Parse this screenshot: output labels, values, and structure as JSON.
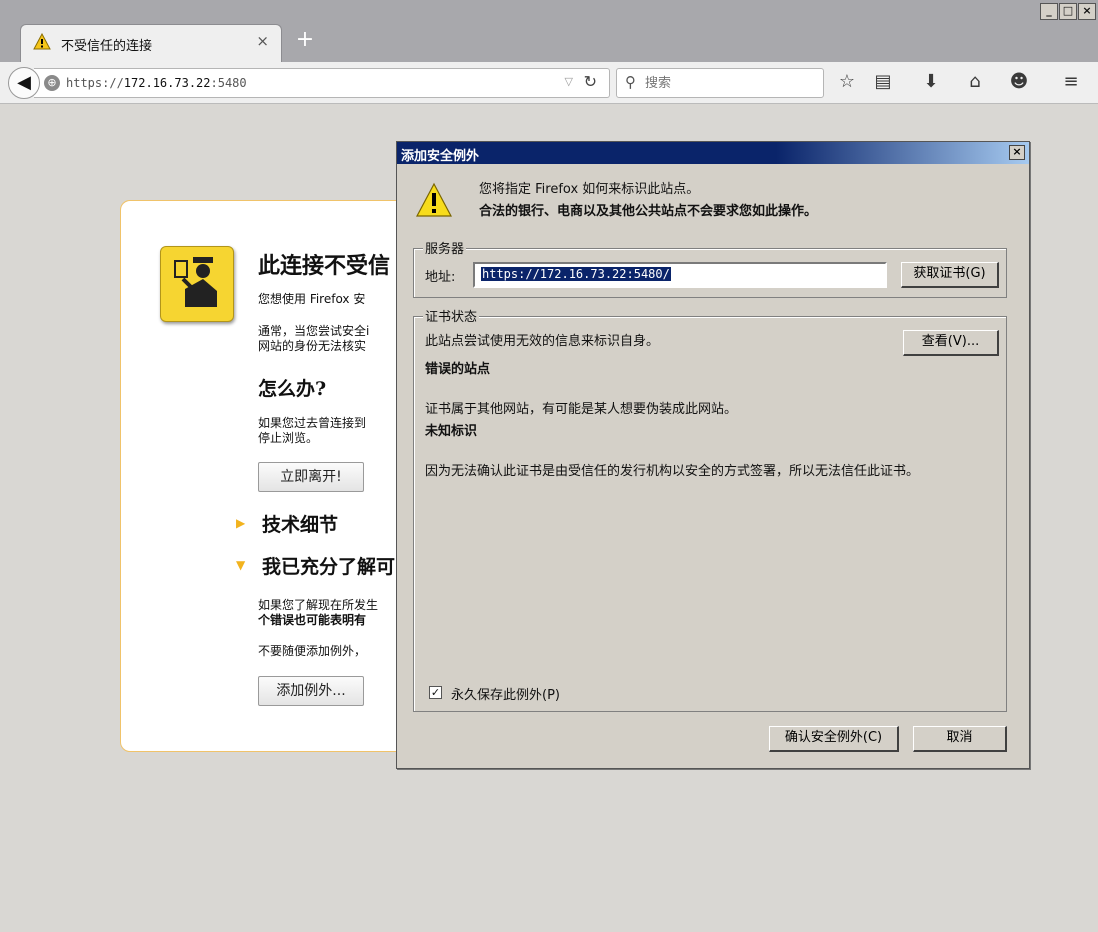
{
  "browser": {
    "tab_title": "不受信任的连接",
    "tab_close": "×",
    "new_tab": "+",
    "window_controls": [
      "_",
      "□",
      "×"
    ],
    "url_prefix": "https://",
    "url_host": "172.16.73.22",
    "url_suffix": ":5480",
    "search_placeholder": "搜索"
  },
  "page": {
    "title": "此连接不受信",
    "line1": "您想使用 Firefox 安",
    "line2a": "通常，当您尝试安全i",
    "line2b": "网站的身份无法核实",
    "what_heading": "怎么办?",
    "line3a": "如果您过去曾连接到",
    "line3b": "停止浏览。",
    "leave_button": "立即离开!",
    "tech_details": "技术细节",
    "understand_risks": "我已充分了解可",
    "line4a": "如果您了解现在所发生",
    "line4b": "个错误也可能表明有",
    "line5": "不要随便添加例外，",
    "add_exception_button": "添加例外..."
  },
  "dialog": {
    "title": "添加安全例外",
    "close": "×",
    "intro1": "您将指定 Firefox 如何来标识此站点。",
    "intro2": "合法的银行、电商以及其他公共站点不会要求您如此操作。",
    "server_legend": "服务器",
    "address_label": "地址:",
    "address_value": "https://172.16.73.22:5480/",
    "get_cert_button": "获取证书(G)",
    "cert_status_legend": "证书状态",
    "status_line1": "此站点尝试使用无效的信息来标识自身。",
    "view_button": "查看(V)...",
    "wrong_site": "错误的站点",
    "status_line2": "证书属于其他网站，有可能是某人想要伪装成此网站。",
    "unknown_identity": "未知标识",
    "status_line3": "因为无法确认此证书是由受信任的发行机构以安全的方式签署，所以无法信任此证书。",
    "permanent_label": "永久保存此例外(P)",
    "permanent_checked": true,
    "confirm_button": "确认安全例外(C)",
    "cancel_button": "取消"
  }
}
